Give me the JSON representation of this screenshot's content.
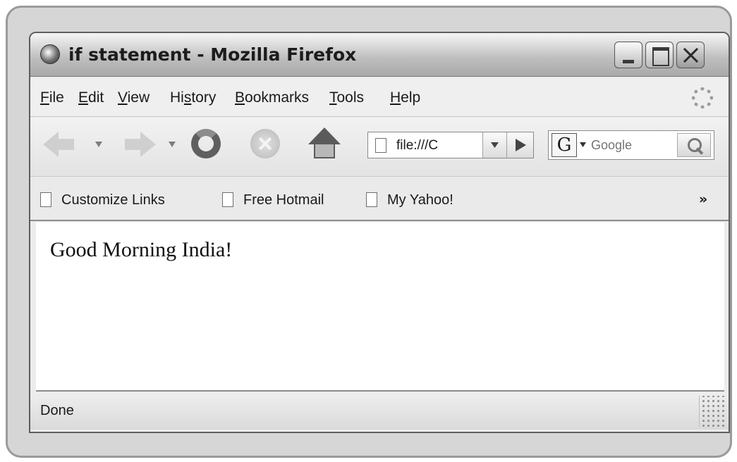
{
  "window": {
    "title": "if statement - Mozilla Firefox"
  },
  "menu": [
    {
      "accel": "F",
      "rest": "ile"
    },
    {
      "accel": "E",
      "rest": "dit"
    },
    {
      "accel": "V",
      "rest": "iew"
    },
    {
      "pre": "Hi",
      "accel": "s",
      "rest": "tory"
    },
    {
      "accel": "B",
      "rest": "ookmarks"
    },
    {
      "accel": "T",
      "rest": "ools"
    },
    {
      "accel": "H",
      "rest": "elp"
    }
  ],
  "nav": {
    "url": "file:///C"
  },
  "search": {
    "engine_letter": "G",
    "placeholder": "Google"
  },
  "bookmarks": {
    "items": [
      "Customize Links",
      "Free Hotmail",
      "My Yahoo!"
    ],
    "overflow": "»"
  },
  "content": {
    "text": "Good Morning India!"
  },
  "status": {
    "text": "Done"
  },
  "icons": [
    "firefox-icon",
    "minimize-icon",
    "maximize-icon",
    "close-icon",
    "throbber-icon",
    "back-arrow-icon",
    "forward-arrow-icon",
    "reload-icon",
    "stop-icon",
    "home-icon",
    "page-icon",
    "dropdown-icon",
    "go-icon",
    "google-icon",
    "search-icon",
    "resize-grip-icon"
  ]
}
